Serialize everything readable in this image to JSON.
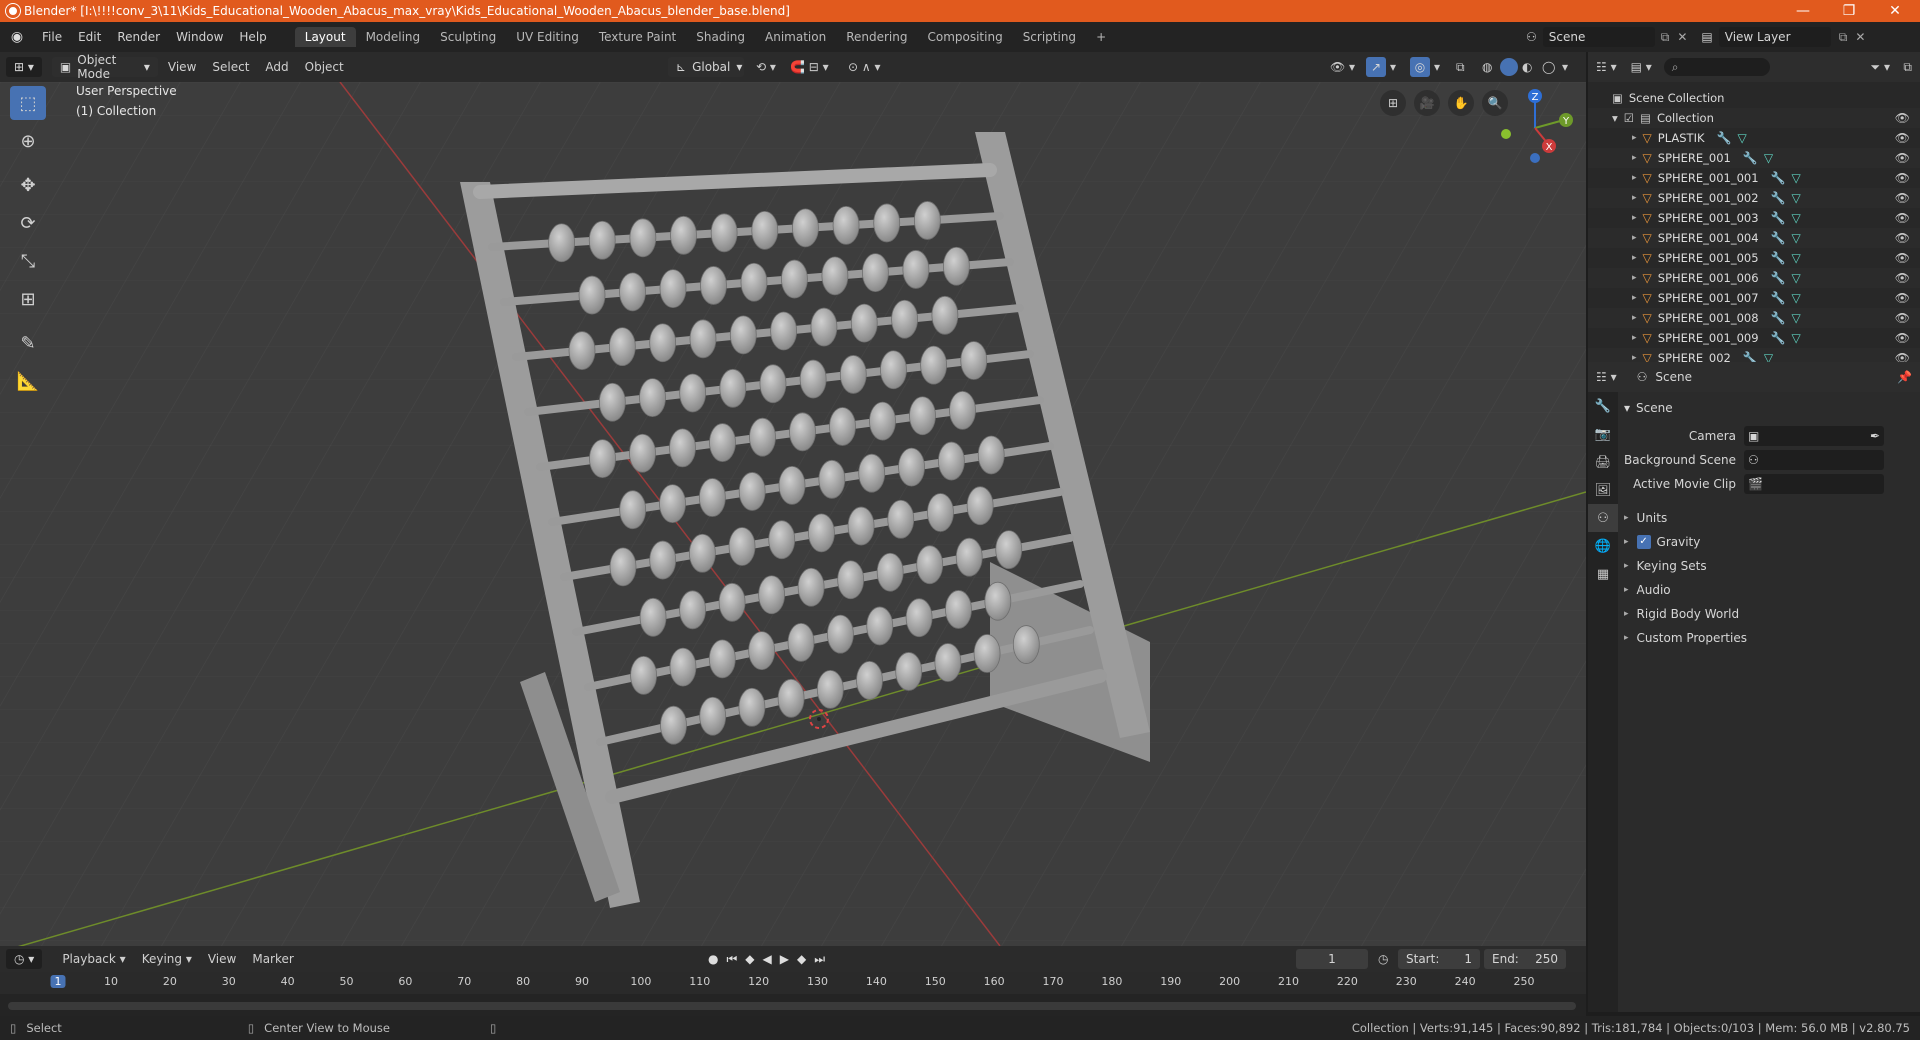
{
  "window": {
    "title": "Blender* [I:\\!!!!conv_3\\11\\Kids_Educational_Wooden_Abacus_max_vray\\Kids_Educational_Wooden_Abacus_blender_base.blend]",
    "minimize": "—",
    "maximize": "❐",
    "close": "✕"
  },
  "menu": [
    "File",
    "Edit",
    "Render",
    "Window",
    "Help"
  ],
  "workspaces": [
    "Layout",
    "Modeling",
    "Sculpting",
    "UV Editing",
    "Texture Paint",
    "Shading",
    "Animation",
    "Rendering",
    "Compositing",
    "Scripting"
  ],
  "scene_selector": "Scene",
  "view_layer": "View Layer",
  "viewport_header": {
    "mode": "Object Mode",
    "menus": [
      "View",
      "Select",
      "Add",
      "Object"
    ],
    "transform_orientation": "Global"
  },
  "viewport": {
    "perspective": "User Perspective",
    "collection": "(1) Collection",
    "gizmo_axes": [
      "Z",
      "Y",
      "X"
    ]
  },
  "outliner": {
    "root": "Scene Collection",
    "collection": "Collection",
    "items": [
      "PLASTIK",
      "SPHERE_001",
      "SPHERE_001_001",
      "SPHERE_001_002",
      "SPHERE_001_003",
      "SPHERE_001_004",
      "SPHERE_001_005",
      "SPHERE_001_006",
      "SPHERE_001_007",
      "SPHERE_001_008",
      "SPHERE_001_009",
      "SPHERE_002"
    ]
  },
  "properties": {
    "context": "Scene",
    "panel_title": "Scene",
    "camera_label": "Camera",
    "background_scene_label": "Background Scene",
    "active_movie_clip_label": "Active Movie Clip",
    "sections": [
      "Units",
      "Gravity",
      "Keying Sets",
      "Audio",
      "Rigid Body World",
      "Custom Properties"
    ],
    "gravity_checked": true
  },
  "timeline": {
    "menus": [
      "Playback",
      "Keying",
      "View",
      "Marker"
    ],
    "current_frame": "1",
    "start_label": "Start:",
    "start": "1",
    "end_label": "End:",
    "end": "250",
    "ruler": [
      "1",
      "10",
      "20",
      "30",
      "40",
      "50",
      "60",
      "70",
      "80",
      "90",
      "100",
      "110",
      "120",
      "130",
      "140",
      "150",
      "160",
      "170",
      "180",
      "190",
      "200",
      "210",
      "220",
      "230",
      "240",
      "250"
    ]
  },
  "status": {
    "select": "Select",
    "center_view": "Center View to Mouse",
    "stats": "Collection | Verts:91,145 | Faces:90,892 | Tris:181,784 | Objects:0/103 | Mem: 56.0 MB | v2.80.75"
  },
  "colors": {
    "title_bar": "#e15a1e",
    "accent": "#4772b3",
    "viewport_bg": "#3d3d3d"
  }
}
